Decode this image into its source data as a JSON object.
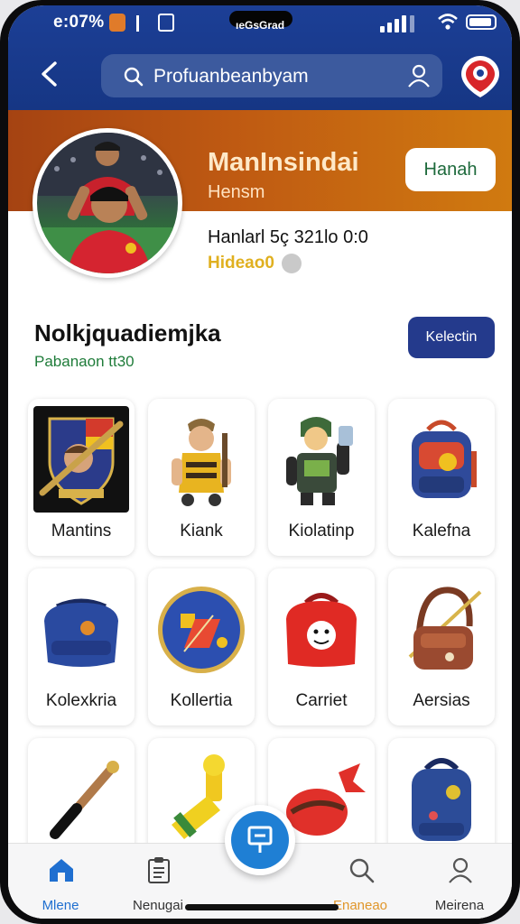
{
  "status_bar": {
    "time": "e:07%",
    "carrier": "ıeGsGrad"
  },
  "search": {
    "placeholder": "Profuanbeanbyam"
  },
  "profile": {
    "name": "ManInsindai",
    "subtitle": "Hensm",
    "follow_label": "Hanah",
    "stats": "Hanlarl 5ç 321lo 0:0",
    "tag": "Hideao0"
  },
  "section": {
    "title": "Nolkjquadiemjka",
    "subtitle": "Pabanaon tt30",
    "button_label": "Kelectin"
  },
  "items": [
    {
      "label": "Mantins",
      "icon": "shield-crest-icon"
    },
    {
      "label": "Kiank",
      "icon": "mascot-figure-icon"
    },
    {
      "label": "Kiolatinp",
      "icon": "robot-figure-icon"
    },
    {
      "label": "Kalefna",
      "icon": "backpack-icon"
    },
    {
      "label": "Kolexkria",
      "icon": "blue-bag-icon"
    },
    {
      "label": "Kollertia",
      "icon": "badge-icon"
    },
    {
      "label": "Carriet",
      "icon": "red-bag-icon"
    },
    {
      "label": "Aersias",
      "icon": "crossbody-bag-icon"
    },
    {
      "label": "",
      "icon": "baton-icon"
    },
    {
      "label": "",
      "icon": "horn-icon"
    },
    {
      "label": "",
      "icon": "red-ornament-icon"
    },
    {
      "label": "",
      "icon": "blue-backpack-icon"
    }
  ],
  "nav": {
    "home": "Mlene",
    "list": "Nenugai",
    "search": "Enaneao",
    "profile": "Meirena"
  },
  "colors": {
    "header_blue": "#1c3f96",
    "banner_orange": "#bf5a12",
    "accent_green": "#1f7c3a",
    "button_navy": "#243a8c",
    "fab_blue": "#1f7fd4",
    "nav_active": "#1f6fd0",
    "nav_search": "#e0962a"
  }
}
